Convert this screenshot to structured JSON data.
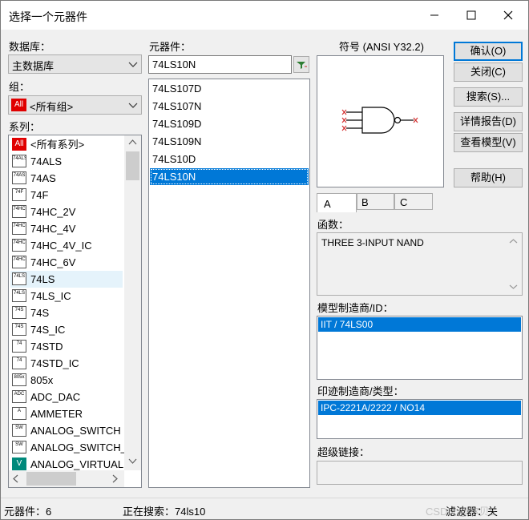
{
  "window": {
    "title": "选择一个元器件",
    "minimize_icon": "minimize-icon",
    "maximize_icon": "maximize-icon",
    "close_icon": "close-icon"
  },
  "left": {
    "database_label": "数据库：",
    "database_value": "主数据库",
    "group_label": "组：",
    "group_value": "<所有组>",
    "group_icon_text": "All",
    "series_label": "系列：",
    "series": [
      {
        "icon": "All",
        "label": "<所有系列>"
      },
      {
        "icon": "74ALS",
        "label": "74ALS"
      },
      {
        "icon": "74AS",
        "label": "74AS"
      },
      {
        "icon": "74F",
        "label": "74F"
      },
      {
        "icon": "74HC",
        "label": "74HC_2V"
      },
      {
        "icon": "74HC",
        "label": "74HC_4V"
      },
      {
        "icon": "74HC",
        "label": "74HC_4V_IC"
      },
      {
        "icon": "74HC",
        "label": "74HC_6V"
      },
      {
        "icon": "74LS",
        "label": "74LS"
      },
      {
        "icon": "74LS",
        "label": "74LS_IC"
      },
      {
        "icon": "74S",
        "label": "74S"
      },
      {
        "icon": "74S",
        "label": "74S_IC"
      },
      {
        "icon": "74",
        "label": "74STD"
      },
      {
        "icon": "74",
        "label": "74STD_IC"
      },
      {
        "icon": "805x",
        "label": "805x"
      },
      {
        "icon": "ADC",
        "label": "ADC_DAC"
      },
      {
        "icon": "A",
        "label": "AMMETER"
      },
      {
        "icon": "SW",
        "label": "ANALOG_SWITCH"
      },
      {
        "icon": "SW",
        "label": "ANALOG_SWITCH_IC"
      },
      {
        "icon": "V",
        "label": "ANALOG_VIRTUAL"
      }
    ]
  },
  "middle": {
    "component_label": "元器件：",
    "search_value": "74LS10N",
    "filter_icon": "filter-icon",
    "components": [
      "74LS107D",
      "74LS107N",
      "74LS109D",
      "74LS109N",
      "74LS10D",
      "74LS10N"
    ],
    "selected_index": 5
  },
  "right": {
    "symbol_label": "符号 (ANSI Y32.2)",
    "tabs": [
      "A",
      "B",
      "C"
    ],
    "function_label": "函数：",
    "function_value": "THREE 3-INPUT NAND",
    "model_label": "模型制造商/ID：",
    "model_value": "IIT / 74LS00",
    "footprint_label": "印迹制造商/类型：",
    "footprint_value": "IPC-2221A/2222 / NO14",
    "hyperlink_label": "超级链接："
  },
  "buttons": {
    "ok": "确认(O)",
    "close": "关闭(C)",
    "search": "搜索(S)...",
    "detail_report": "详情报告(D)",
    "view_model": "查看模型(V)",
    "help": "帮助(H)"
  },
  "status": {
    "count": "元器件：6",
    "searching": "正在搜索：74ls10",
    "filter_off": "滤波器：关",
    "watermark": "CSDN @尔贝5"
  },
  "colors": {
    "selection": "#0078d7",
    "window_bg": "#f0f0f0",
    "default_border": "#0078d7"
  }
}
